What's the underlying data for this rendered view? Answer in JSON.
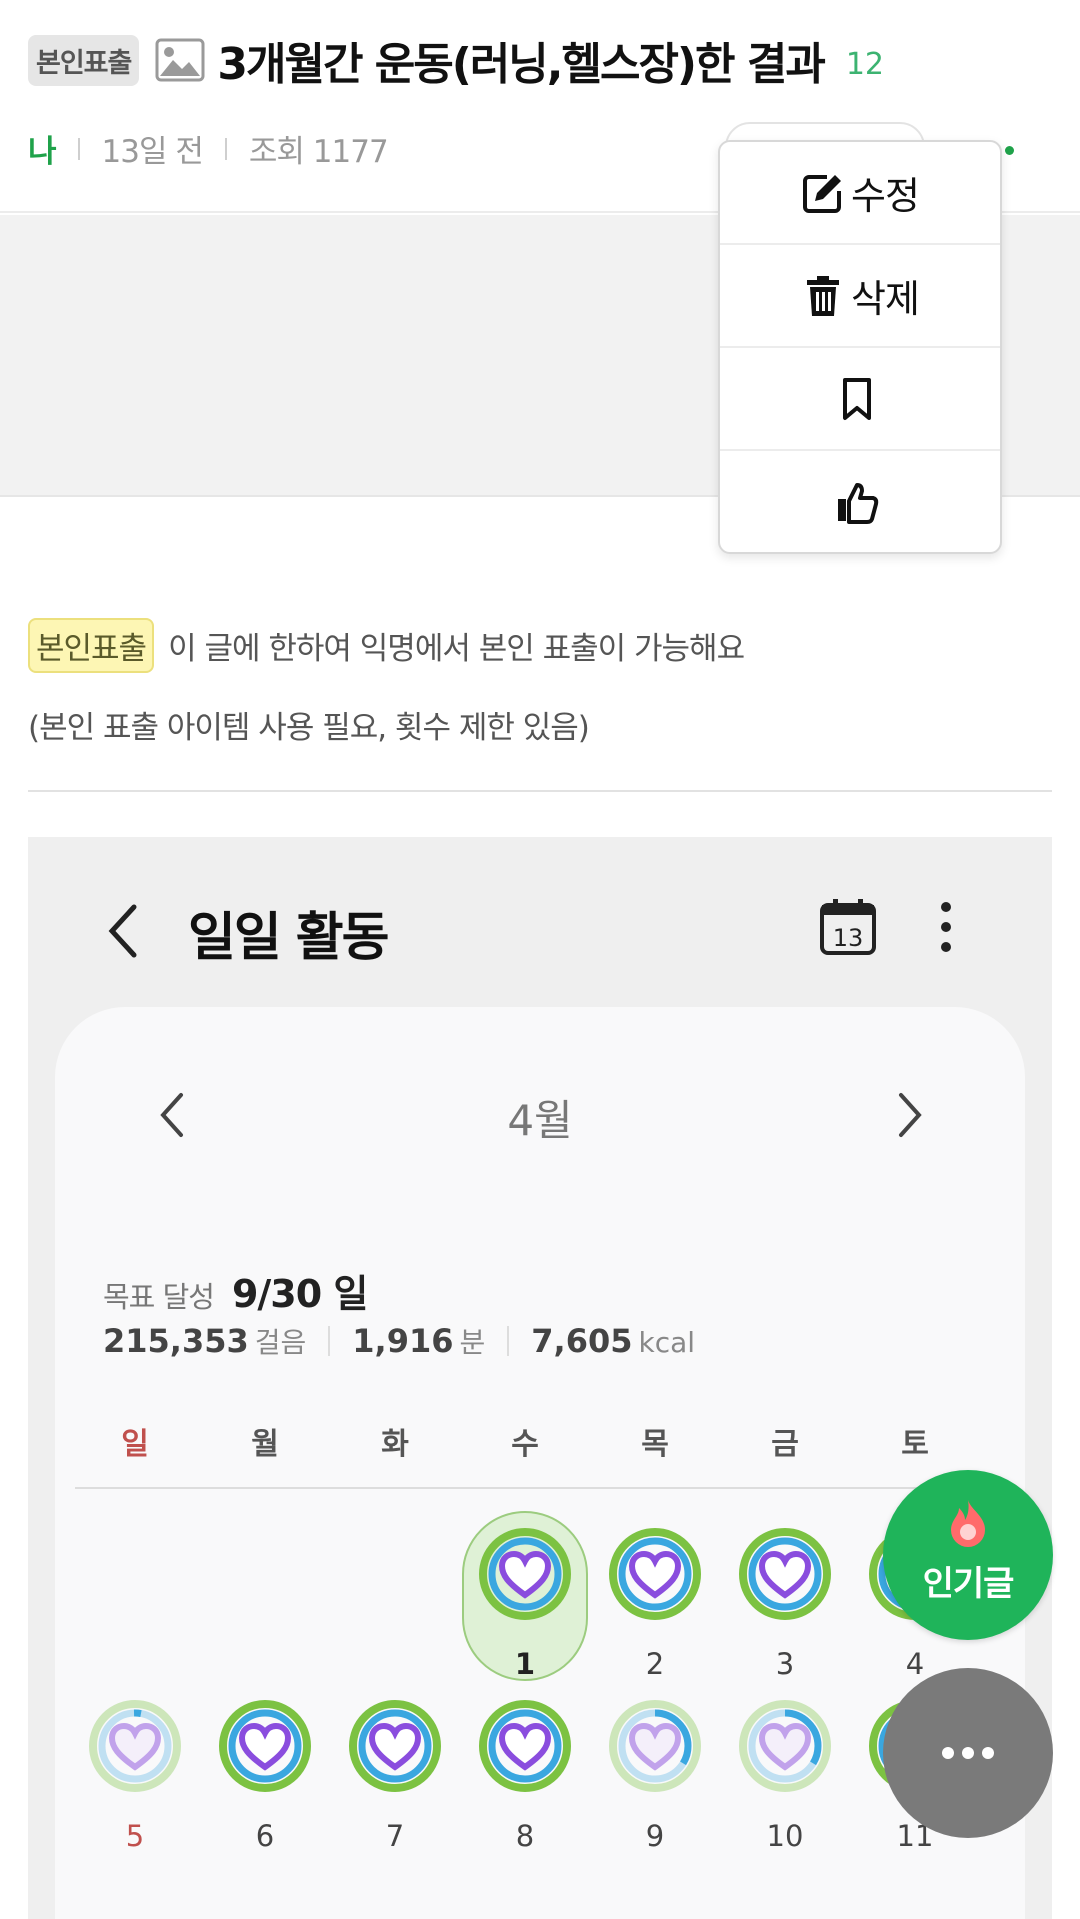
{
  "post": {
    "badge": "본인표출",
    "title": "3개월간 운동(러닝,헬스장)한 결과",
    "comment_count": "12",
    "author": "나",
    "time_ago": "13일 전",
    "views": "조회 1177"
  },
  "menu": {
    "items": [
      {
        "label": "수정",
        "icon": "edit-icon"
      },
      {
        "label": "삭제",
        "icon": "trash-icon"
      },
      {
        "label": "",
        "icon": "bookmark-icon"
      },
      {
        "label": "",
        "icon": "thumbs-up-icon"
      }
    ]
  },
  "notice": {
    "badge": "본인표출",
    "text": "이 글에 한하여 익명에서 본인 표출이 가능해요",
    "sub": "(본인 표출 아이템 사용 필요, 횟수 제한 있음)"
  },
  "screenshot": {
    "app_title": "일일 활동",
    "calendar_icon_day": "13",
    "month": "4월",
    "goal_label": "목표 달성",
    "goal_value": "9/30 일",
    "steps_value": "215,353",
    "steps_unit": "걸음",
    "minutes_value": "1,916",
    "minutes_unit": "분",
    "kcal_value": "7,605",
    "kcal_unit": "kcal",
    "weekdays": [
      "일",
      "월",
      "화",
      "수",
      "목",
      "금",
      "토"
    ],
    "days": [
      {
        "num": "1",
        "level": "full"
      },
      {
        "num": "2",
        "level": "full"
      },
      {
        "num": "3",
        "level": "full"
      },
      {
        "num": "4",
        "level": "full"
      },
      {
        "num": "5",
        "level": "low"
      },
      {
        "num": "6",
        "level": "full"
      },
      {
        "num": "7",
        "level": "full"
      },
      {
        "num": "8",
        "level": "full"
      },
      {
        "num": "9",
        "level": "partial"
      },
      {
        "num": "10",
        "level": "partial"
      },
      {
        "num": "11",
        "level": "full"
      }
    ]
  },
  "fab": {
    "hot_label": "인기글"
  },
  "colors": {
    "accent_green": "#1fa24a",
    "fab_green": "#1fb45a",
    "sunday_red": "#c0504d",
    "ring_green": "#7cc242",
    "ring_blue": "#3aa7e0",
    "heart_purple": "#8a4dde"
  }
}
